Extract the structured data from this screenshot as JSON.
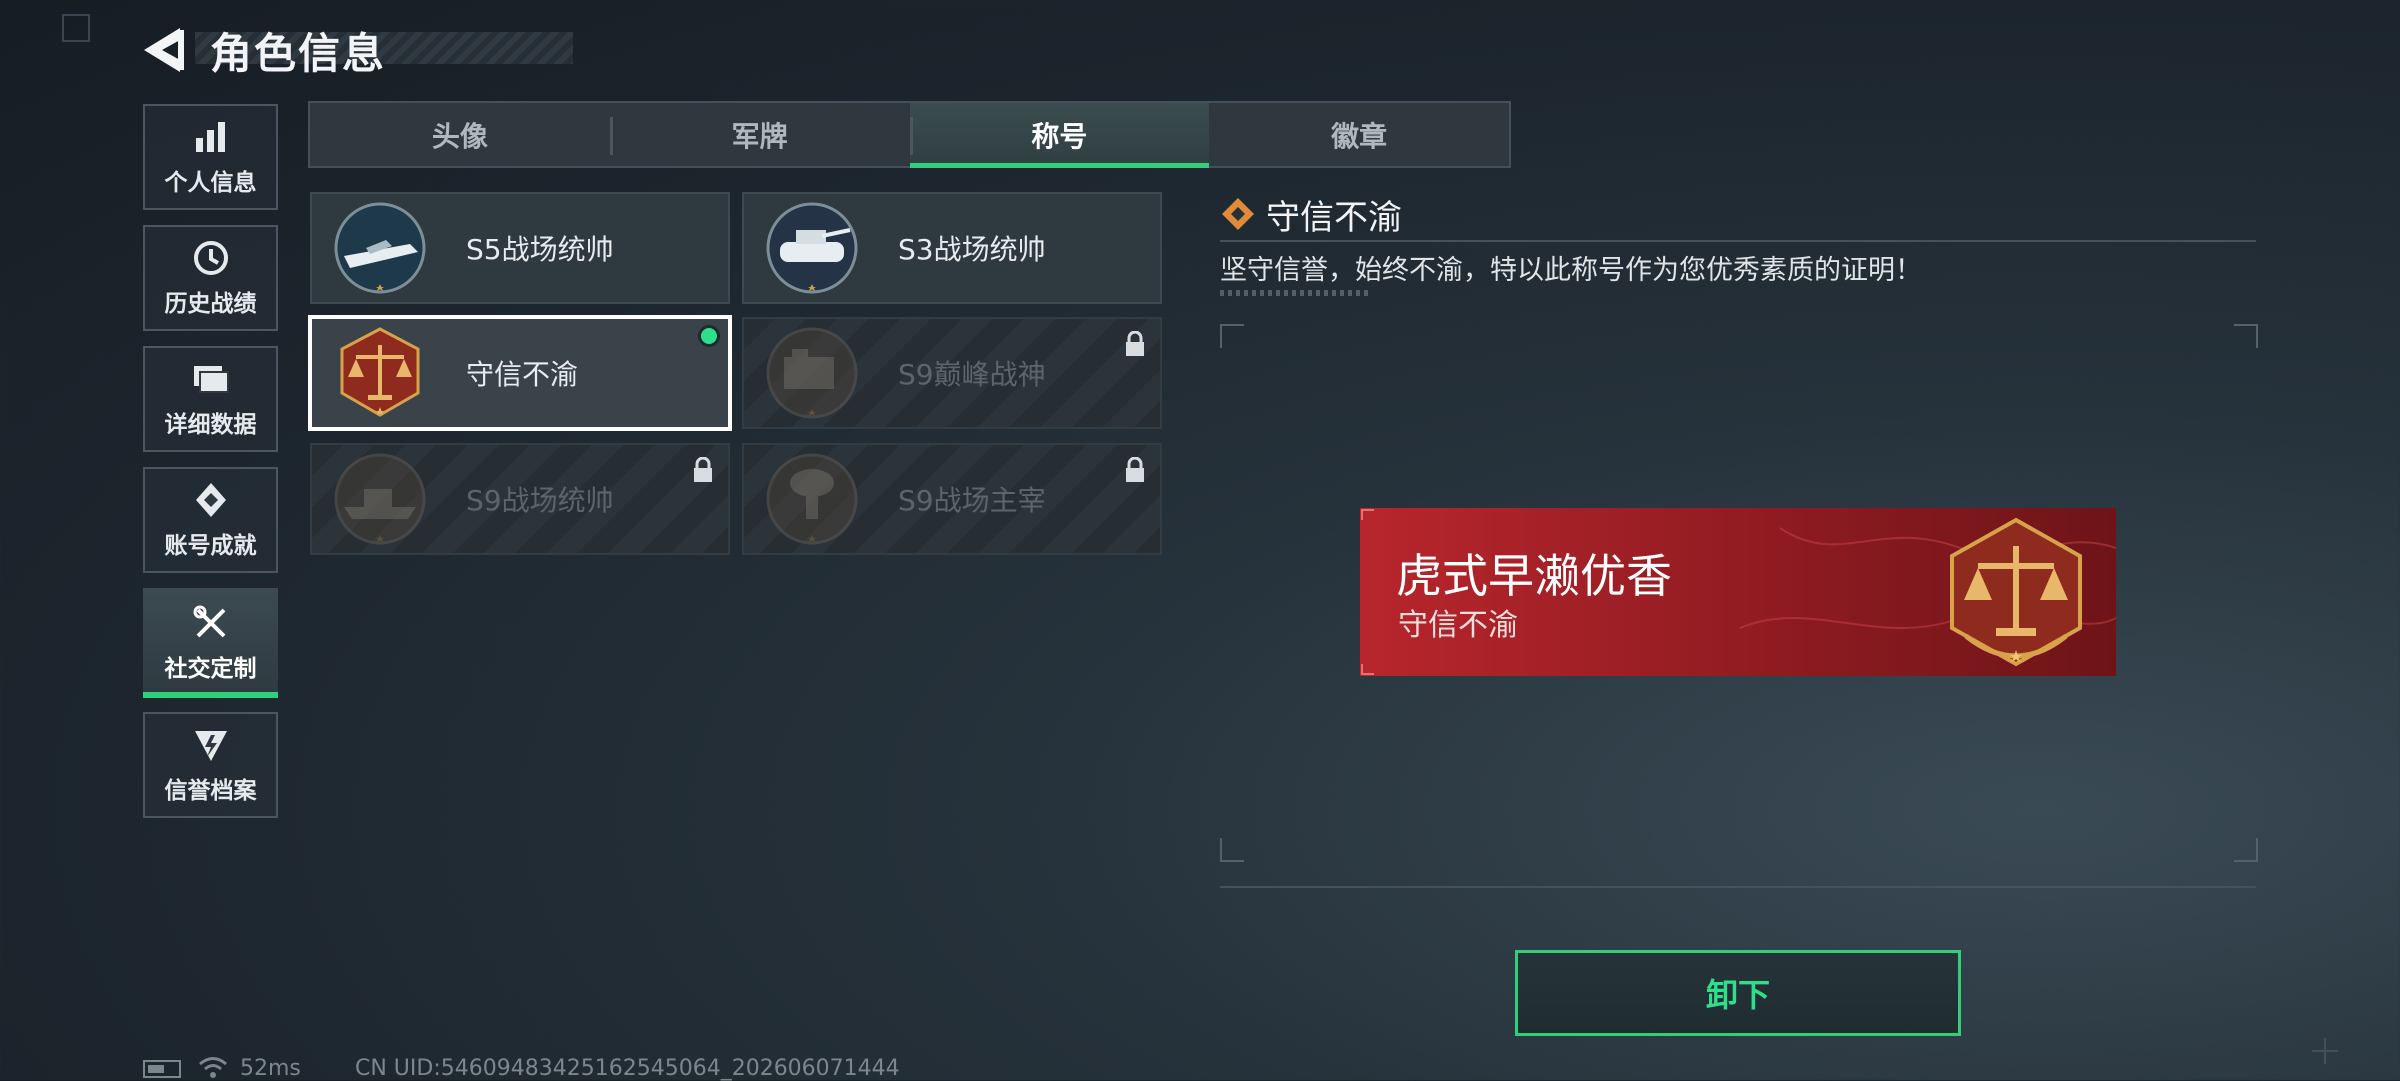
{
  "header": {
    "title": "角色信息"
  },
  "sidebar": {
    "items": [
      {
        "label": "个人信息",
        "icon": "bar-chart-icon"
      },
      {
        "label": "历史战绩",
        "icon": "clock-history-icon"
      },
      {
        "label": "详细数据",
        "icon": "folder-stack-icon"
      },
      {
        "label": "账号成就",
        "icon": "achievement-badge-icon"
      },
      {
        "label": "社交定制",
        "icon": "crossed-tools-icon",
        "active": true
      },
      {
        "label": "信誉档案",
        "icon": "shield-lightning-icon"
      }
    ]
  },
  "tabs": [
    {
      "label": "头像"
    },
    {
      "label": "军牌"
    },
    {
      "label": "称号",
      "active": true
    },
    {
      "label": "徽章"
    }
  ],
  "titles": [
    {
      "name": "S5战场统帅",
      "locked": false
    },
    {
      "name": "S3战场统帅",
      "locked": false
    },
    {
      "name": "守信不渝",
      "locked": false,
      "selected": true,
      "equipped": true
    },
    {
      "name": "S9巅峰战神",
      "locked": true
    },
    {
      "name": "S9战场统帅",
      "locked": true
    },
    {
      "name": "S9战场主宰",
      "locked": true
    }
  ],
  "detail": {
    "title": "守信不渝",
    "description": "坚守信誉，始终不渝，特以此称号作为您优秀素质的证明！"
  },
  "preview": {
    "player_name": "虎式早濑优香",
    "title": "守信不渝"
  },
  "actions": {
    "unequip_label": "卸下"
  },
  "status": {
    "ping": "52ms",
    "uid": "CN UID:5460948342516254506​4_202606071444"
  },
  "colors": {
    "accent": "#2fcf7c",
    "banner_red": "#b8262c",
    "medal_gold": "#d8a24a"
  }
}
